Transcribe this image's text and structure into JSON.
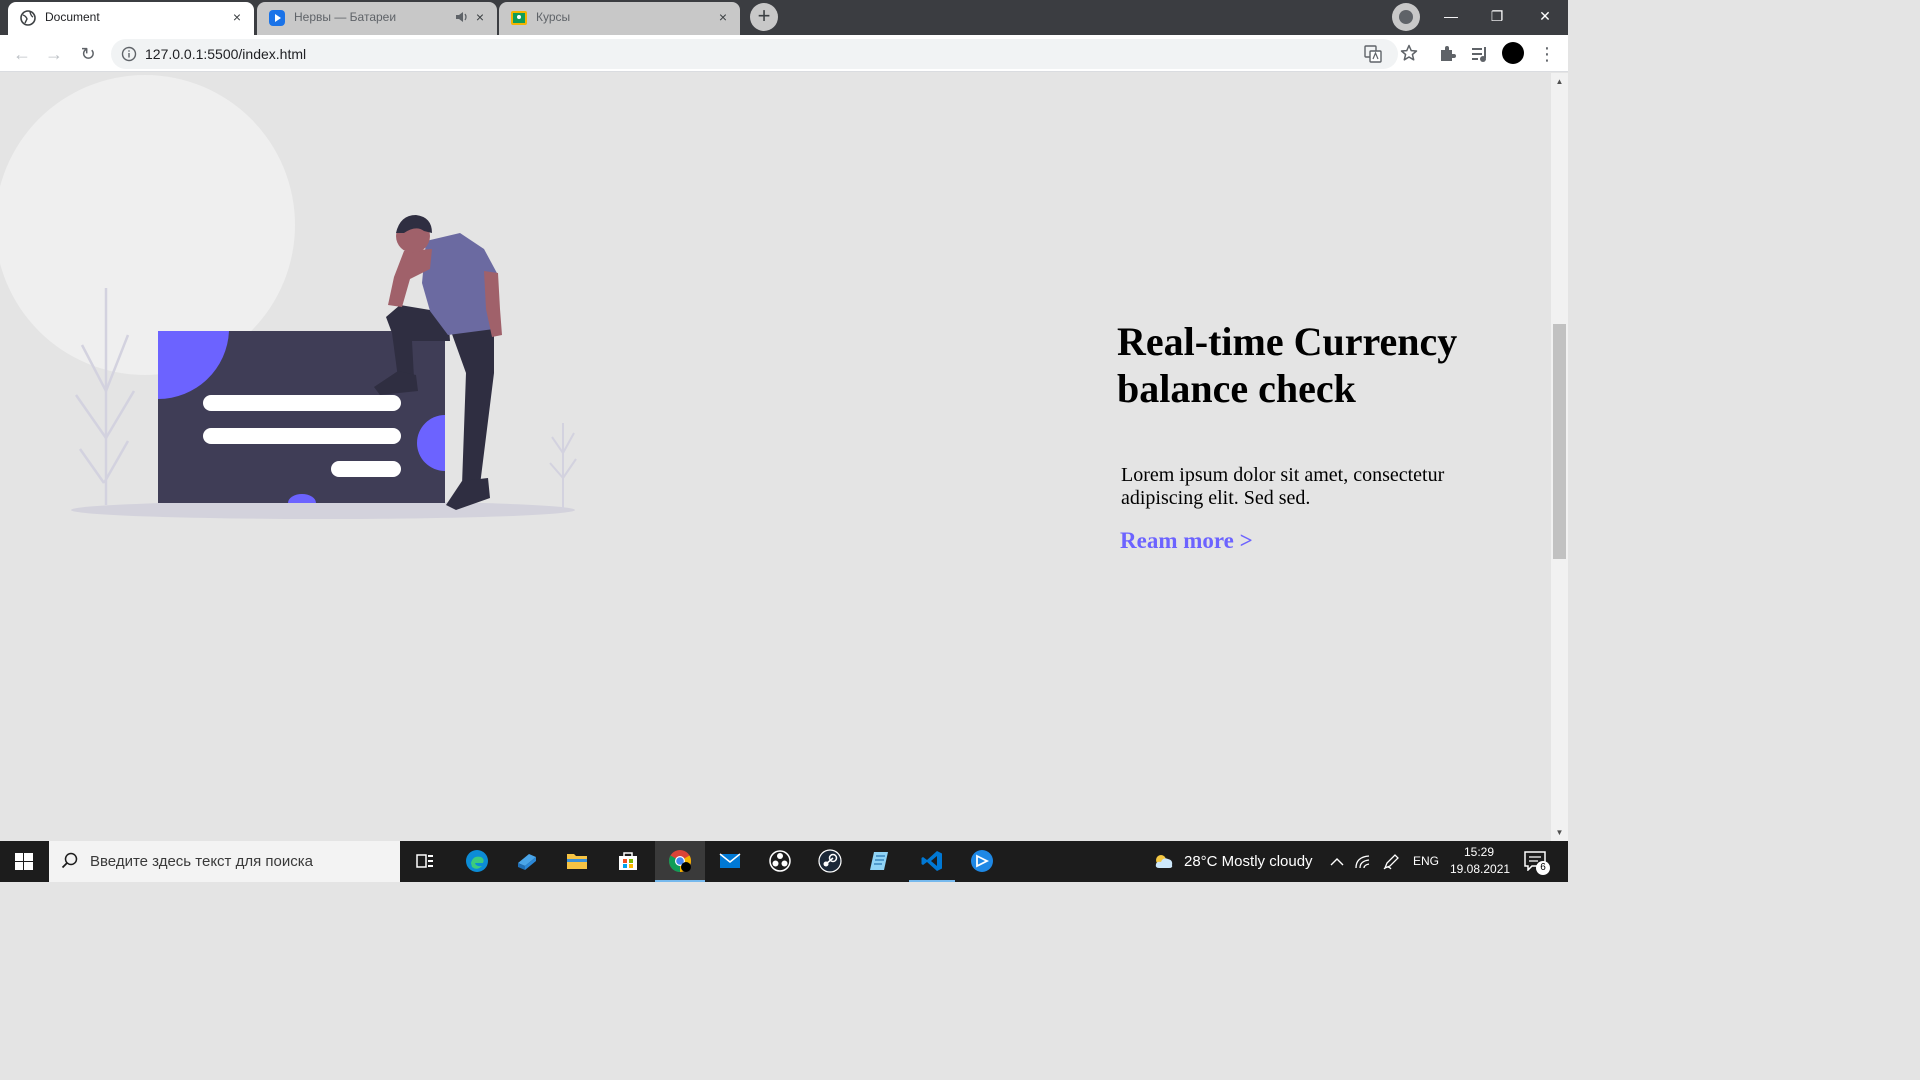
{
  "browser": {
    "tabs": [
      {
        "title": "Document",
        "active": true,
        "close": "×"
      },
      {
        "title": "Нервы — Батареи",
        "active": false,
        "close": "×",
        "audio": true
      },
      {
        "title": "Курсы",
        "active": false,
        "close": "×"
      }
    ],
    "new_tab": "+",
    "window": {
      "minimize": "—",
      "restore": "❐",
      "close": "✕"
    },
    "nav": {
      "back": "←",
      "forward": "→",
      "reload": "↻"
    },
    "address": "127.0.0.1:5500/index.html",
    "menu": "⋮"
  },
  "page": {
    "title": "Real-time Currency balance check",
    "text": "Lorem ipsum dolor sit amet, consectetur adipiscing elit. Sed sed.",
    "link": "Ream more >",
    "accent": "#6c63ff"
  },
  "scrollbar": {
    "up": "▲",
    "down": "▼",
    "position": 0.33
  },
  "taskbar": {
    "search_placeholder": "Введите здесь текст для поиска",
    "apps": [
      "task-view",
      "edge",
      "azure-data-studio",
      "file-explorer",
      "microsoft-store",
      "chrome",
      "mail",
      "obs",
      "steam",
      "notepad",
      "vscode",
      "remote-desktop"
    ],
    "weather": "28°C  Mostly cloudy",
    "language": "ENG",
    "time": "15:29",
    "date": "19.08.2021",
    "notifications": "6"
  }
}
